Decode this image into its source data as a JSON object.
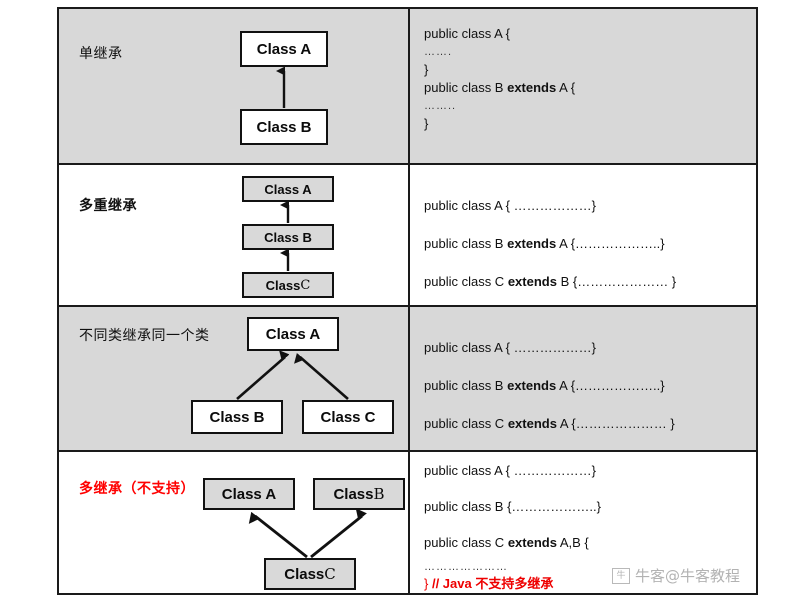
{
  "diagram": {
    "title_semantic": "java-inheritance-types-table",
    "colors": {
      "shaded_row_bg": "#d8d8d8",
      "plain_row_bg": "#ffffff",
      "box_border": "#111111",
      "box_fill_white": "#ffffff",
      "box_fill_gray": "#d9d9d9",
      "accent_red": "#ff0000",
      "text": "#111111"
    },
    "rows": [
      {
        "label": "单继承",
        "shaded": true,
        "boxes": [
          {
            "name": "Class A"
          },
          {
            "name": "Class B"
          }
        ],
        "code_lines": [
          "public class A {",
          "…….",
          "}",
          "public class B extends A {",
          "……..",
          "}"
        ]
      },
      {
        "label": "多重继承",
        "shaded": false,
        "boxes": [
          {
            "name": "Class A"
          },
          {
            "name": "Class B"
          },
          {
            "name": "Class C"
          }
        ],
        "code_lines": [
          "public class A { ………………}",
          "public class B extends A {………………..}",
          "public class C extends  B {………………… }"
        ]
      },
      {
        "label": "不同类继承同一个类",
        "shaded": true,
        "boxes": [
          {
            "name": "Class A"
          },
          {
            "name": "Class B"
          },
          {
            "name": "Class C"
          }
        ],
        "code_lines": [
          "public class A { ………………}",
          "public class B extends A {………………..}",
          "public class C extends A {………………… }"
        ]
      },
      {
        "label": "多继承（不支持）",
        "shaded": false,
        "boxes": [
          {
            "name": "Class A"
          },
          {
            "name": "Class B"
          },
          {
            "name": "Class C"
          }
        ],
        "code_lines": [
          "public class A { ………………}",
          "public class B {………………..}",
          "public class C extends  A,B {",
          "…………………",
          "} // Java  不支持多继承"
        ]
      }
    ]
  },
  "code": {
    "r1": {
      "l1": "public class A {",
      "l2": "…….",
      "l3": "}",
      "l4_pre": "public class B ",
      "l4_kw": "extends",
      "l4_post": " A {",
      "l5": "……..",
      "l6": "}"
    },
    "r2": {
      "l1": "public class A { ………………}",
      "l2_pre": "public class B ",
      "l2_kw": "extends",
      "l2_post": " A {………………..}",
      "l3_pre": "public class C ",
      "l3_kw": "extends",
      "l3_post": "  B {………………… }"
    },
    "r3": {
      "l1": "public class A { ………………}",
      "l2_pre": "public class B ",
      "l2_kw": "extends",
      "l2_post": " A {………………..}",
      "l3_pre": "public class C ",
      "l3_kw": "extends",
      "l3_post": " A {………………… }"
    },
    "r4": {
      "l1": "public class A { ………………}",
      "l2": "public class B {………………..}",
      "l3_pre": "public class C ",
      "l3_kw": "extends",
      "l3_post": "  A,B {",
      "l4": "…………………",
      "l5_brace": "} ",
      "l5_comment": "// Java  不支持多继承"
    }
  },
  "boxes": {
    "r1": {
      "a": "Class A",
      "b": "Class B"
    },
    "r2": {
      "a": "Class A",
      "b": "Class B",
      "c_pre": "Class ",
      "c_letter": "C"
    },
    "r3": {
      "a": "Class A",
      "b": "Class B",
      "c": "Class C"
    },
    "r4": {
      "a": "Class A",
      "b_pre": "Class ",
      "b_letter": "B",
      "c_pre": "Class ",
      "c_letter": "C"
    }
  },
  "labels": {
    "r1": "单继承",
    "r2": "多重继承",
    "r3": "不同类继承同一个类",
    "r4": "多继承（不支持）"
  },
  "watermark": {
    "logo_text": "牛",
    "text": "牛客@牛客教程"
  }
}
